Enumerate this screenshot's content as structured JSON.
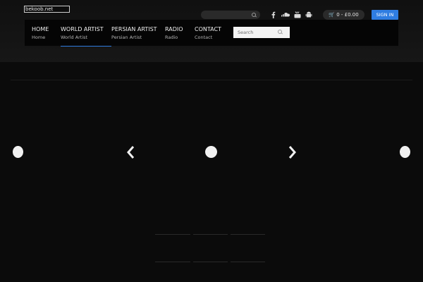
{
  "logo_text": "bekoob.net",
  "social": [
    "facebook-icon",
    "soundcloud-icon",
    "youtube-icon",
    "android-icon"
  ],
  "cart": {
    "text": "0 - £0.00"
  },
  "signin": "SIGN IN",
  "nav": [
    {
      "label": "HOME",
      "sub": "Home"
    },
    {
      "label": "WORLD ARTIST",
      "sub": "World Artist"
    },
    {
      "label": "PERSIAN ARTIST",
      "sub": "Persian Artist"
    },
    {
      "label": "RADIO",
      "sub": "Radio"
    },
    {
      "label": "CONTACT",
      "sub": "Contact"
    }
  ],
  "search": {
    "placeholder": "Search"
  },
  "colors": {
    "accent": "#2f7de1",
    "background": "#0b0b0b"
  }
}
